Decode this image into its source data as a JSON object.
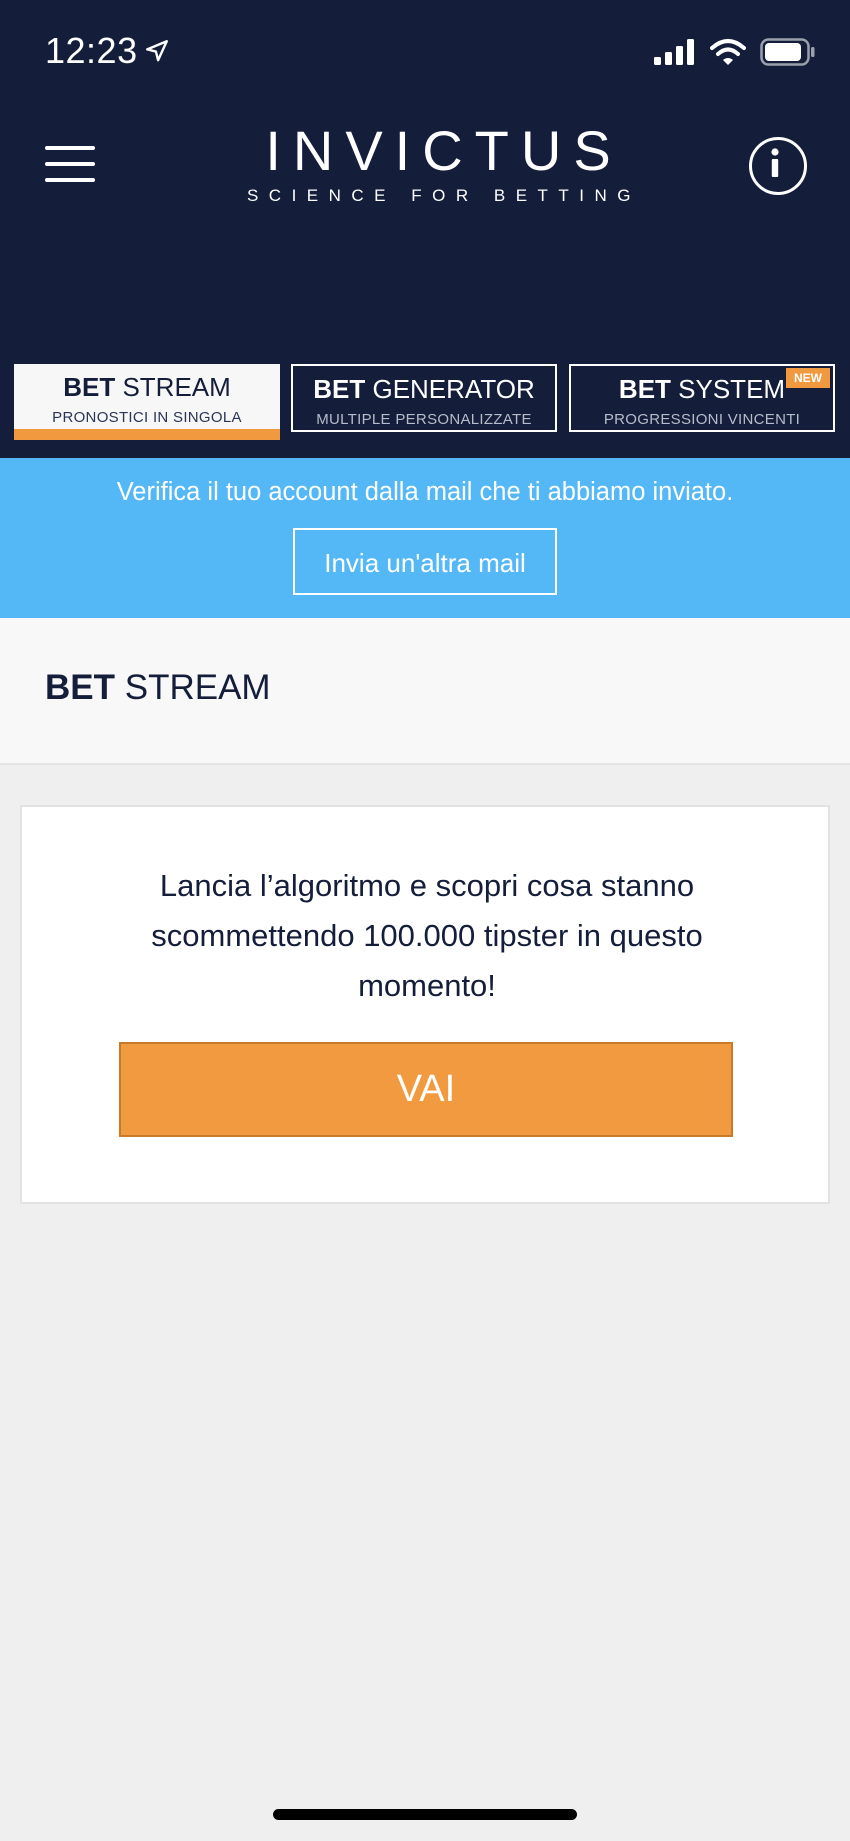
{
  "status_bar": {
    "time": "12:23",
    "location_icon": "location-arrow-icon",
    "signal_icon": "signal-icon",
    "wifi_icon": "wifi-icon",
    "battery_icon": "battery-icon"
  },
  "header": {
    "logo_title": "INVICTUS",
    "logo_subtitle": "SCIENCE FOR BETTING",
    "menu_icon": "hamburger-menu-icon",
    "info_icon": "info-icon"
  },
  "tabs": [
    {
      "bold": "BET",
      "label": "STREAM",
      "subtitle": "PRONOSTICI IN SINGOLA",
      "active": true
    },
    {
      "bold": "BET",
      "label": "GENERATOR",
      "subtitle": "MULTIPLE PERSONALIZZATE",
      "active": false
    },
    {
      "bold": "BET",
      "label": "SYSTEM",
      "subtitle": "PROGRESSIONI VINCENTI",
      "active": false,
      "badge": "NEW"
    }
  ],
  "banner": {
    "text": "Verifica il tuo account dalla mail che ti abbiamo inviato.",
    "button_label": "Invia un'altra mail"
  },
  "section": {
    "title_bold": "BET",
    "title_rest": "STREAM"
  },
  "card": {
    "text": "Lancia l’algoritmo e scopri cosa stanno scommettendo 100.000 tipster in questo momento!",
    "button_label": "VAI"
  },
  "colors": {
    "navy": "#141e3a",
    "accent_orange": "#f0993e",
    "banner_blue": "#55b8f6"
  }
}
